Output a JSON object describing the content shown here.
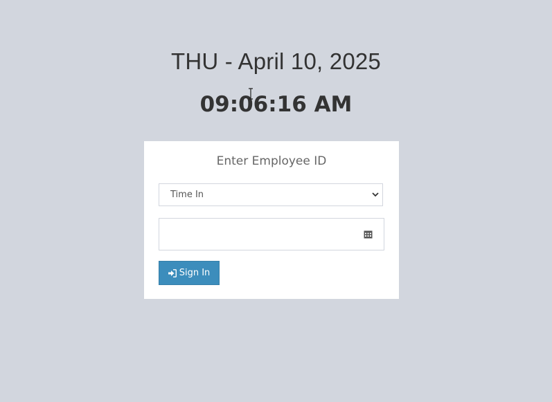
{
  "clock": {
    "date": "THU - April 10, 2025",
    "time": "09:06:16 AM"
  },
  "login": {
    "title": "Enter Employee ID",
    "mode_select": {
      "selected": "Time In"
    },
    "employee_input": {
      "value": "",
      "icon": "calendar-icon"
    },
    "signin_label": "Sign In",
    "signin_icon": "sign-in-icon"
  },
  "colors": {
    "background": "#d2d6de",
    "box": "#ffffff",
    "primary": "#3c8dbc",
    "text": "#333333"
  }
}
